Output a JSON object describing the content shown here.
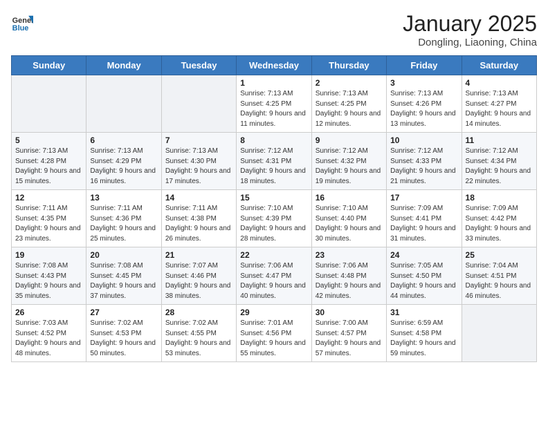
{
  "header": {
    "logo_general": "General",
    "logo_blue": "Blue",
    "title": "January 2025",
    "subtitle": "Dongling, Liaoning, China"
  },
  "days_of_week": [
    "Sunday",
    "Monday",
    "Tuesday",
    "Wednesday",
    "Thursday",
    "Friday",
    "Saturday"
  ],
  "weeks": [
    [
      {
        "day": "",
        "empty": true
      },
      {
        "day": "",
        "empty": true
      },
      {
        "day": "",
        "empty": true
      },
      {
        "day": "1",
        "sunrise": "7:13 AM",
        "sunset": "4:25 PM",
        "daylight": "9 hours and 11 minutes."
      },
      {
        "day": "2",
        "sunrise": "7:13 AM",
        "sunset": "4:25 PM",
        "daylight": "9 hours and 12 minutes."
      },
      {
        "day": "3",
        "sunrise": "7:13 AM",
        "sunset": "4:26 PM",
        "daylight": "9 hours and 13 minutes."
      },
      {
        "day": "4",
        "sunrise": "7:13 AM",
        "sunset": "4:27 PM",
        "daylight": "9 hours and 14 minutes."
      }
    ],
    [
      {
        "day": "5",
        "sunrise": "7:13 AM",
        "sunset": "4:28 PM",
        "daylight": "9 hours and 15 minutes."
      },
      {
        "day": "6",
        "sunrise": "7:13 AM",
        "sunset": "4:29 PM",
        "daylight": "9 hours and 16 minutes."
      },
      {
        "day": "7",
        "sunrise": "7:13 AM",
        "sunset": "4:30 PM",
        "daylight": "9 hours and 17 minutes."
      },
      {
        "day": "8",
        "sunrise": "7:12 AM",
        "sunset": "4:31 PM",
        "daylight": "9 hours and 18 minutes."
      },
      {
        "day": "9",
        "sunrise": "7:12 AM",
        "sunset": "4:32 PM",
        "daylight": "9 hours and 19 minutes."
      },
      {
        "day": "10",
        "sunrise": "7:12 AM",
        "sunset": "4:33 PM",
        "daylight": "9 hours and 21 minutes."
      },
      {
        "day": "11",
        "sunrise": "7:12 AM",
        "sunset": "4:34 PM",
        "daylight": "9 hours and 22 minutes."
      }
    ],
    [
      {
        "day": "12",
        "sunrise": "7:11 AM",
        "sunset": "4:35 PM",
        "daylight": "9 hours and 23 minutes."
      },
      {
        "day": "13",
        "sunrise": "7:11 AM",
        "sunset": "4:36 PM",
        "daylight": "9 hours and 25 minutes."
      },
      {
        "day": "14",
        "sunrise": "7:11 AM",
        "sunset": "4:38 PM",
        "daylight": "9 hours and 26 minutes."
      },
      {
        "day": "15",
        "sunrise": "7:10 AM",
        "sunset": "4:39 PM",
        "daylight": "9 hours and 28 minutes."
      },
      {
        "day": "16",
        "sunrise": "7:10 AM",
        "sunset": "4:40 PM",
        "daylight": "9 hours and 30 minutes."
      },
      {
        "day": "17",
        "sunrise": "7:09 AM",
        "sunset": "4:41 PM",
        "daylight": "9 hours and 31 minutes."
      },
      {
        "day": "18",
        "sunrise": "7:09 AM",
        "sunset": "4:42 PM",
        "daylight": "9 hours and 33 minutes."
      }
    ],
    [
      {
        "day": "19",
        "sunrise": "7:08 AM",
        "sunset": "4:43 PM",
        "daylight": "9 hours and 35 minutes."
      },
      {
        "day": "20",
        "sunrise": "7:08 AM",
        "sunset": "4:45 PM",
        "daylight": "9 hours and 37 minutes."
      },
      {
        "day": "21",
        "sunrise": "7:07 AM",
        "sunset": "4:46 PM",
        "daylight": "9 hours and 38 minutes."
      },
      {
        "day": "22",
        "sunrise": "7:06 AM",
        "sunset": "4:47 PM",
        "daylight": "9 hours and 40 minutes."
      },
      {
        "day": "23",
        "sunrise": "7:06 AM",
        "sunset": "4:48 PM",
        "daylight": "9 hours and 42 minutes."
      },
      {
        "day": "24",
        "sunrise": "7:05 AM",
        "sunset": "4:50 PM",
        "daylight": "9 hours and 44 minutes."
      },
      {
        "day": "25",
        "sunrise": "7:04 AM",
        "sunset": "4:51 PM",
        "daylight": "9 hours and 46 minutes."
      }
    ],
    [
      {
        "day": "26",
        "sunrise": "7:03 AM",
        "sunset": "4:52 PM",
        "daylight": "9 hours and 48 minutes."
      },
      {
        "day": "27",
        "sunrise": "7:02 AM",
        "sunset": "4:53 PM",
        "daylight": "9 hours and 50 minutes."
      },
      {
        "day": "28",
        "sunrise": "7:02 AM",
        "sunset": "4:55 PM",
        "daylight": "9 hours and 53 minutes."
      },
      {
        "day": "29",
        "sunrise": "7:01 AM",
        "sunset": "4:56 PM",
        "daylight": "9 hours and 55 minutes."
      },
      {
        "day": "30",
        "sunrise": "7:00 AM",
        "sunset": "4:57 PM",
        "daylight": "9 hours and 57 minutes."
      },
      {
        "day": "31",
        "sunrise": "6:59 AM",
        "sunset": "4:58 PM",
        "daylight": "9 hours and 59 minutes."
      },
      {
        "day": "",
        "empty": true
      }
    ]
  ]
}
